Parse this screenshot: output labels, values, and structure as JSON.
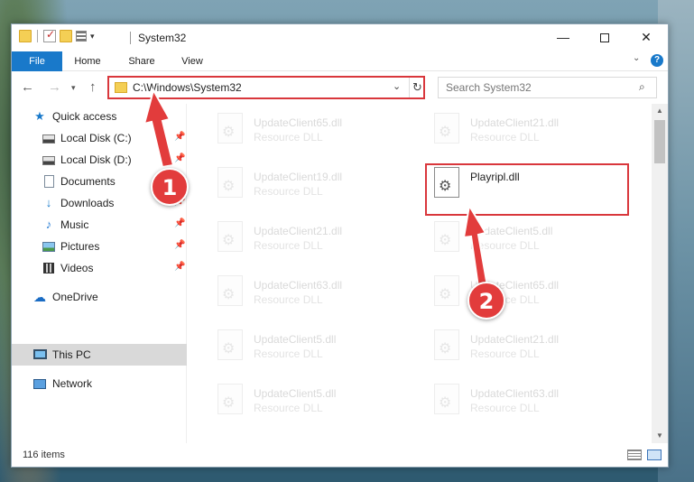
{
  "window": {
    "title": "System32",
    "controls": {
      "minimize": "—",
      "maximize": "",
      "close": "✕"
    }
  },
  "ribbon": {
    "tabs": [
      "File",
      "Home",
      "Share",
      "View"
    ],
    "help": "?"
  },
  "nav": {
    "address": "C:\\Windows\\System32",
    "search_placeholder": "Search System32"
  },
  "sidebar": {
    "items": [
      {
        "label": "Quick access",
        "icon": "star-icon",
        "pinned": false
      },
      {
        "label": "Local Disk (C:)",
        "icon": "drive-icon",
        "pinned": true
      },
      {
        "label": "Local Disk (D:)",
        "icon": "drive-icon",
        "pinned": true
      },
      {
        "label": "Documents",
        "icon": "document-icon",
        "pinned": true
      },
      {
        "label": "Downloads",
        "icon": "download-icon",
        "pinned": true
      },
      {
        "label": "Music",
        "icon": "music-icon",
        "pinned": true
      },
      {
        "label": "Pictures",
        "icon": "pictures-icon",
        "pinned": true
      },
      {
        "label": "Videos",
        "icon": "video-icon",
        "pinned": true
      },
      {
        "label": "OneDrive",
        "icon": "cloud-icon",
        "pinned": false
      },
      {
        "label": "This PC",
        "icon": "computer-icon",
        "pinned": false,
        "selected": true
      },
      {
        "label": "Network",
        "icon": "network-icon",
        "pinned": false
      }
    ]
  },
  "files": {
    "left_column": [
      {
        "name": "UpdateClient65.dll",
        "type": "Resource DLL"
      },
      {
        "name": "UpdateClient19.dll",
        "type": "Resource DLL"
      },
      {
        "name": "UpdateClient21.dll",
        "type": "Resource DLL"
      },
      {
        "name": "UpdateClient63.dll",
        "type": "Resource DLL"
      },
      {
        "name": "UpdateClient5.dll",
        "type": "Resource DLL"
      },
      {
        "name": "UpdateClient5.dll",
        "type": "Resource DLL"
      }
    ],
    "right_column": [
      {
        "name": "UpdateClient21.dll",
        "type": "Resource DLL"
      },
      {
        "name": "Playripl.dll",
        "type": "",
        "highlight": true
      },
      {
        "name": "UpdateClient5.dll",
        "type": "Resource DLL"
      },
      {
        "name": "UpdateClient65.dll",
        "type": "Resource DLL"
      },
      {
        "name": "UpdateClient21.dll",
        "type": "Resource DLL"
      },
      {
        "name": "UpdateClient63.dll",
        "type": "Resource DLL"
      }
    ]
  },
  "status": {
    "item_count": "116 items"
  },
  "annotations": {
    "step1": "1",
    "step2": "2",
    "color": "#e23c3c"
  }
}
